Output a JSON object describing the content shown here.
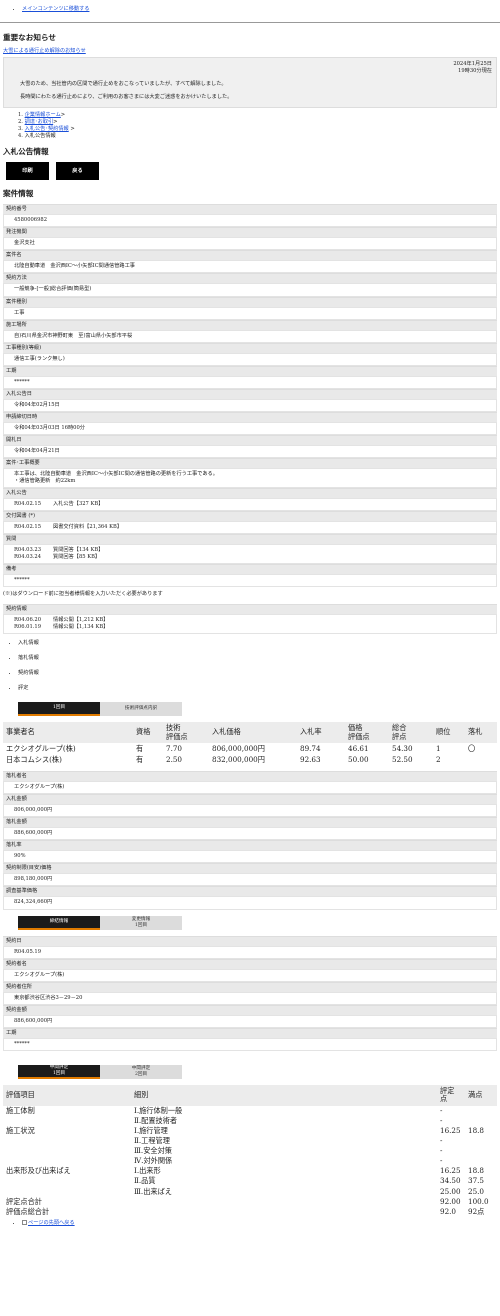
{
  "skip_link": "メインコンテンツに移動する",
  "important": {
    "heading": "重要なお知らせ",
    "link": "大雪による通行止め解除のお知らせ",
    "date_line1": "2024年1月25日",
    "date_line2": "19時30分現在",
    "para1": "大雪のため、当社管内の区間で通行止めをおこなっていましたが、すべて解除しました。",
    "para2": "長時間にわたる通行止めにより、ご利用のお客さまには大変ご迷惑をおかけいたしました。"
  },
  "breadcrumb": {
    "n1": "1.",
    "i1": "企業情報ホーム",
    "s1": ">",
    "n2": "2.",
    "i2": "調達･お取引",
    "s2": ">",
    "n3": "3.",
    "i3": "入札公告･契約情報",
    "s3": ">",
    "n4": "4.",
    "i4": "入札公告情報"
  },
  "page_title": "入札公告情報",
  "buttons": {
    "print": "印刷",
    "back": "戻る"
  },
  "case_heading": "案件情報",
  "fields": {
    "contract_no_lbl": "契約番号",
    "contract_no": "4580006982",
    "agency_lbl": "発注機関",
    "agency": "金沢支社",
    "case_name_lbl": "案件名",
    "case_name": "北陸自動車道　金沢西IC～小矢部IC間通信管路工事",
    "method_lbl": "契約方法",
    "method": "一般競争-[一般]総合評価(簡易型)",
    "type_lbl": "案件種別",
    "type": "工事",
    "location_lbl": "施工場所",
    "location": "自)石川県金沢市神野町東　至)富山県小矢部市平桜",
    "work_type_lbl": "工事種別(等級)",
    "work_type": "通信工事(ランク無し)",
    "period_lbl": "工期",
    "period": "******",
    "notice_date_lbl": "入札公告日",
    "notice_date": "令和04年02月15日",
    "deadline_lbl": "申請締切日時",
    "deadline": "令和04年03月03日 16時00分",
    "opening_lbl": "開札日",
    "opening": "令和04年04月21日",
    "overview_lbl": "案件･工事概要",
    "overview1": "本工事は、北陸自動車道　金沢西IC～小矢部IC間の通信管路の更新を行う工事である。",
    "overview2": "・通信管路更新　約22km",
    "bid_notice_lbl": "入札公告",
    "bid_notice_date": "R04.02.15",
    "bid_notice_doc": "入札公告【327 KB】",
    "issued_lbl": "交付図書 (*)",
    "issued_date": "R04.02.15",
    "issued_doc": "図書交付資料【21,364 KB】",
    "question_lbl": "質問",
    "q1_date": "R04.03.23",
    "q1_doc": "質問回答【134 KB】",
    "q2_date": "R04.03.24",
    "q2_doc": "質問回答【85 KB】",
    "remarks_lbl": "備考",
    "remarks": "******"
  },
  "download_note": "(※)はダウンロード前に担当者様情報を入力いただく必要があります",
  "contract_info": {
    "lbl": "契約情報",
    "d1": "R04.06.20",
    "doc1": "情報公開【1,212 KB】",
    "d2": "R06.01.19",
    "doc2": "情報公開【1,134 KB】"
  },
  "info_links": {
    "bid": "入札情報",
    "award": "落札情報",
    "contract": "契約情報",
    "eval": "評定"
  },
  "bid_tabs": {
    "round1": "1回目",
    "tech": "技術評価点内訳"
  },
  "bid_table": {
    "h_company": "事業者名",
    "h_qual": "資格",
    "h_tech1": "技術",
    "h_tech2": "評価点",
    "h_price": "入札価格",
    "h_rate": "入札率",
    "h_pscore1": "価格",
    "h_pscore2": "評価点",
    "h_total1": "総合",
    "h_total2": "評点",
    "h_rank": "順位",
    "h_award": "落札",
    "rows": [
      {
        "company": "エクシオグループ(株)",
        "qual": "有",
        "tech": "7.70",
        "price": "806,000,000円",
        "rate": "89.74",
        "pscore": "46.61",
        "total": "54.30",
        "rank": "1",
        "award": "〇"
      },
      {
        "company": "日本コムシス(株)",
        "qual": "有",
        "tech": "2.50",
        "price": "832,000,000円",
        "rate": "92.63",
        "pscore": "50.00",
        "total": "52.50",
        "rank": "2",
        "award": ""
      }
    ]
  },
  "award": {
    "winner_lbl": "落札者名",
    "winner": "エクシオグループ(株)",
    "bid_amount_lbl": "入札金額",
    "bid_amount": "806,000,000円",
    "award_amount_lbl": "落札金額",
    "award_amount": "886,600,000円",
    "rate_lbl": "落札率",
    "rate": "90%",
    "limit_lbl": "契約制限(目安)価格",
    "limit": "898,180,000円",
    "base_lbl": "調査基準価格",
    "base": "824,324,660円"
  },
  "contract_tabs": {
    "signed": "締結情報",
    "change1": "変更情報",
    "change2": "1回目"
  },
  "contract_detail": {
    "date_lbl": "契約日",
    "date": "R04.05.19",
    "party_lbl": "契約者名",
    "party": "エクシオグループ(株)",
    "address_lbl": "契約者住所",
    "address": "東京都渋谷区渋谷3－29－20",
    "amount_lbl": "契約金額",
    "amount": "886,600,000円",
    "period_lbl": "工期",
    "period": "******"
  },
  "eval_tabs": {
    "a1": "中間評定",
    "a2": "1回目",
    "b1": "中間評定",
    "b2": "2回目"
  },
  "eval_table": {
    "h_item": "評価項目",
    "h_detail": "細別",
    "h_score1": "評定",
    "h_score2": "点",
    "h_full": "満点",
    "rows": [
      {
        "item": "施工体制",
        "detail": "Ⅰ.施行体制一般",
        "score": "-",
        "full": ""
      },
      {
        "item": "",
        "detail": "Ⅱ.配置技術者",
        "score": "-",
        "full": ""
      },
      {
        "item": "施工状況",
        "detail": "Ⅰ.施行管理",
        "score": "16.25",
        "full": "18.8"
      },
      {
        "item": "",
        "detail": "Ⅱ.工程管理",
        "score": "-",
        "full": ""
      },
      {
        "item": "",
        "detail": "Ⅲ.安全対策",
        "score": "-",
        "full": ""
      },
      {
        "item": "",
        "detail": "Ⅳ.対外関係",
        "score": "-",
        "full": ""
      },
      {
        "item": "出来形及び出来ばえ",
        "detail": "Ⅰ.出来形",
        "score": "16.25",
        "full": "18.8"
      },
      {
        "item": "",
        "detail": "Ⅱ.品質",
        "score": "34.50",
        "full": "37.5"
      },
      {
        "item": "",
        "detail": "Ⅲ.出来ばえ",
        "score": "25.00",
        "full": "25.0"
      },
      {
        "item": "評定点合計",
        "detail": "",
        "score": "92.00",
        "full": "100.0"
      },
      {
        "item": "評価点総合計",
        "detail": "",
        "score": "92.0",
        "full": "92点"
      }
    ]
  },
  "back_to_top": "ページの先頭へ戻る"
}
